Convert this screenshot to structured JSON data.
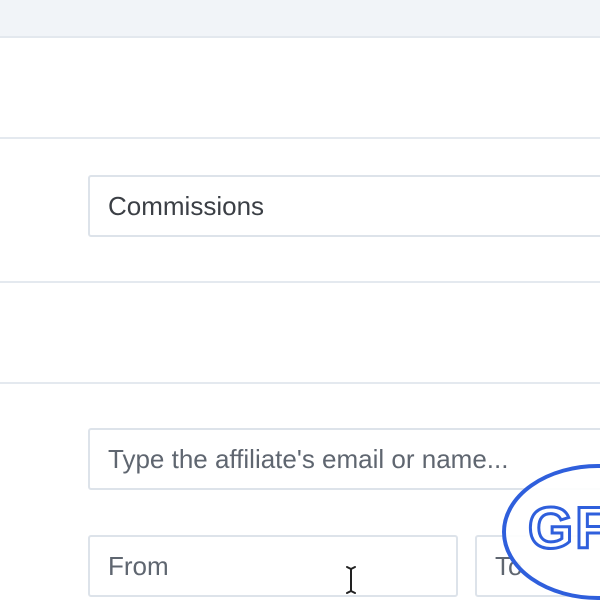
{
  "type_field": {
    "value": "Commissions"
  },
  "affiliate_search": {
    "placeholder": "Type the affiliate's email or name..."
  },
  "date_range": {
    "from_placeholder": "From",
    "to_placeholder": "To"
  },
  "watermark": {
    "text": "GF"
  },
  "colors": {
    "background": "#ffffff",
    "header_band": "#f1f4f8",
    "divider": "#e4e9ef",
    "field_border": "#dde3ea",
    "text": "#3b3f45",
    "watermark_blue": "#2f5fdc"
  }
}
